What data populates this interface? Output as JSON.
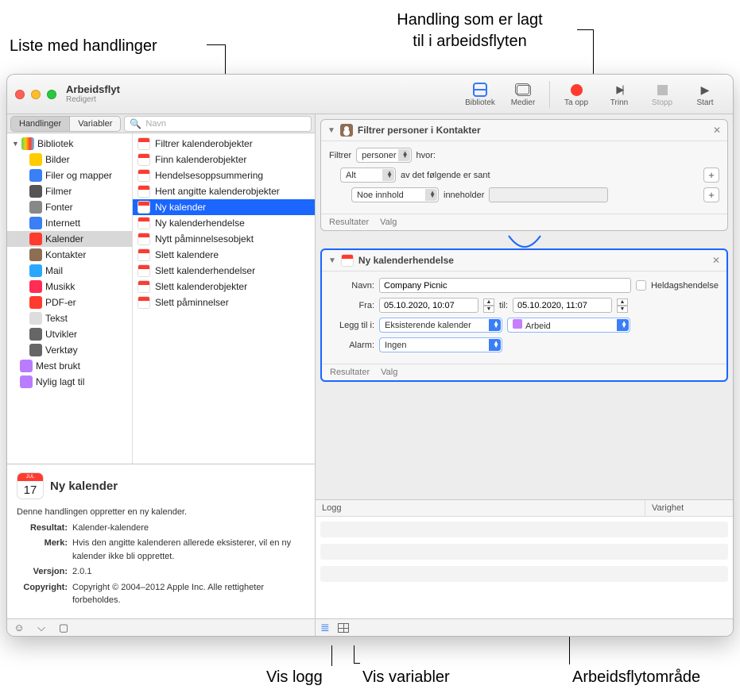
{
  "callouts": {
    "list_actions": "Liste med handlinger",
    "added_action_l1": "Handling som er lagt",
    "added_action_l2": "til i arbeidsflyten",
    "show_log": "Vis logg",
    "show_vars": "Vis variabler",
    "wf_area": "Arbeidsflytområde"
  },
  "titlebar": {
    "title": "Arbeidsflyt",
    "subtitle": "Redigert",
    "btn_library": "Bibliotek",
    "btn_media": "Medier",
    "btn_record": "Ta opp",
    "btn_step": "Trinn",
    "btn_stop": "Stopp",
    "btn_start": "Start"
  },
  "tabs": {
    "actions": "Handlinger",
    "variables": "Variabler",
    "search_ph": "Navn"
  },
  "library": {
    "root": "Bibliotek",
    "items": [
      "Bilder",
      "Filer og mapper",
      "Filmer",
      "Fonter",
      "Internett",
      "Kalender",
      "Kontakter",
      "Mail",
      "Musikk",
      "PDF-er",
      "Tekst",
      "Utvikler",
      "Verktøy"
    ],
    "smart": [
      "Mest brukt",
      "Nylig lagt til"
    ]
  },
  "actions_list": [
    "Filtrer kalenderobjekter",
    "Finn kalenderobjekter",
    "Hendelsesoppsummering",
    "Hent angitte kalenderobjekter",
    "Ny kalender",
    "Ny kalenderhendelse",
    "Nytt påminnelsesobjekt",
    "Slett kalendere",
    "Slett kalenderhendelser",
    "Slett kalenderobjekter",
    "Slett påminnelser"
  ],
  "selected_action_index": 4,
  "desc": {
    "title": "Ny kalender",
    "summary": "Denne handlingen oppretter en ny kalender.",
    "result_l": "Resultat:",
    "result_v": "Kalender-kalendere",
    "merk_l": "Merk:",
    "merk_v": "Hvis den angitte kalenderen allerede eksisterer, vil en ny kalender ikke bli opprettet.",
    "ver_l": "Versjon:",
    "ver_v": "2.0.1",
    "copy_l": "Copyright:",
    "copy_v": "Copyright © 2004–2012 Apple Inc. Alle rettigheter forbeholdes."
  },
  "card1": {
    "title": "Filtrer personer i Kontakter",
    "filter_l": "Filtrer",
    "filter_sel": "personer",
    "where": "hvor:",
    "cond_all": "Alt",
    "cond_text": "av det følgende er sant",
    "field_sel": "Noe innhold",
    "op": "inneholder",
    "foot_results": "Resultater",
    "foot_options": "Valg"
  },
  "card2": {
    "title": "Ny kalenderhendelse",
    "name_l": "Navn:",
    "name_v": "Company Picnic",
    "allday": "Heldagshendelse",
    "from_l": "Fra:",
    "from_v": "05.10.2020, 10:07",
    "to_l": "til:",
    "to_v": "05.10.2020, 11:07",
    "add_l": "Legg til i:",
    "add_sel1": "Eksisterende kalender",
    "add_sel2": "Arbeid",
    "alarm_l": "Alarm:",
    "alarm_sel": "Ingen",
    "foot_results": "Resultater",
    "foot_options": "Valg"
  },
  "log": {
    "h1": "Logg",
    "h2": "Varighet"
  }
}
